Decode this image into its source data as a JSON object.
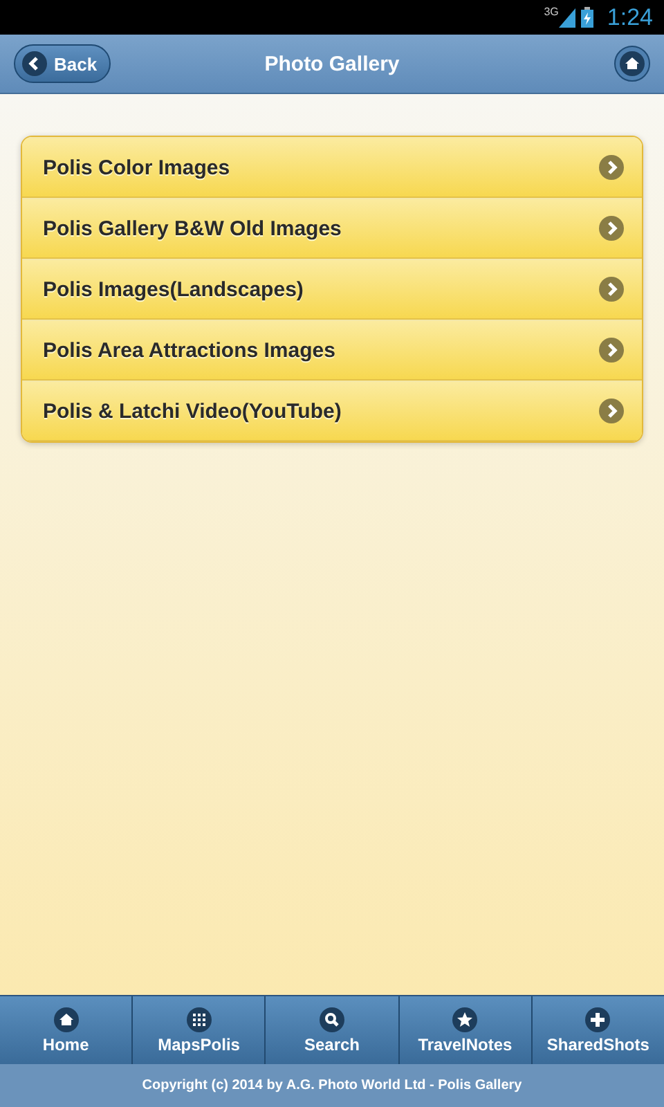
{
  "status_bar": {
    "network": "3G",
    "time": "1:24"
  },
  "header": {
    "back": "Back",
    "title": "Photo Gallery"
  },
  "menu": [
    {
      "label": "Polis Color Images"
    },
    {
      "label": "Polis Gallery B&W Old Images"
    },
    {
      "label": "Polis Images(Landscapes)"
    },
    {
      "label": "Polis Area Attractions Images"
    },
    {
      "label": "Polis & Latchi Video(YouTube)"
    }
  ],
  "tab_bar": [
    {
      "label": "Home"
    },
    {
      "label": "MapsPolis"
    },
    {
      "label": "Search"
    },
    {
      "label": "TravelNotes"
    },
    {
      "label": "SharedShots"
    }
  ],
  "footer": "Copyright (c) 2014 by A.G. Photo World Ltd - Polis Gallery"
}
